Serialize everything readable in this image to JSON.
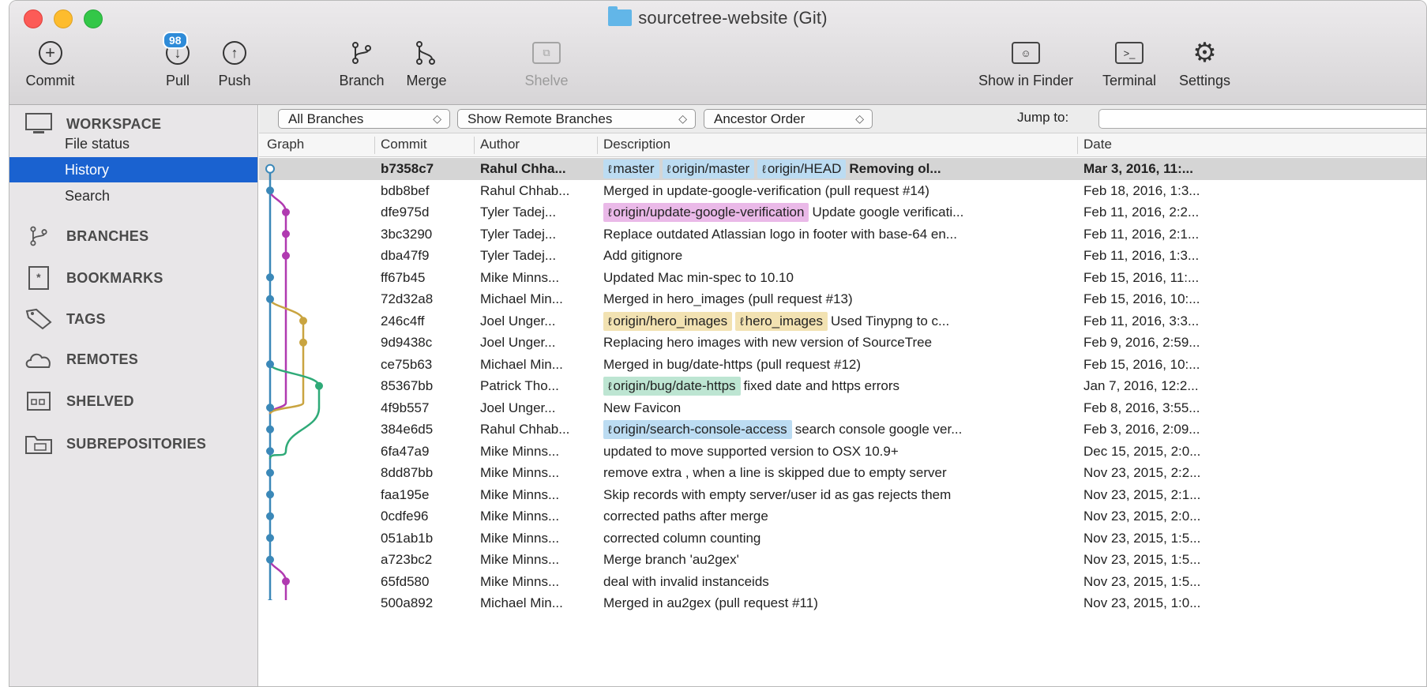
{
  "window": {
    "title": "sourcetree-website (Git)"
  },
  "toolbar": {
    "commit": "Commit",
    "pull": "Pull",
    "pull_badge": "98",
    "push": "Push",
    "branch": "Branch",
    "merge": "Merge",
    "shelve": "Shelve",
    "show_in_finder": "Show in Finder",
    "terminal": "Terminal",
    "settings": "Settings"
  },
  "sidebar": {
    "workspace": "WORKSPACE",
    "workspace_items": [
      "File status",
      "History",
      "Search"
    ],
    "active_item": "History",
    "sections": [
      "BRANCHES",
      "BOOKMARKS",
      "TAGS",
      "REMOTES",
      "SHELVED",
      "SUBREPOSITORIES"
    ]
  },
  "filters": {
    "branches": "All Branches",
    "remote": "Show Remote Branches",
    "order": "Ancestor Order",
    "jump_label": "Jump to:"
  },
  "columns": {
    "graph": "Graph",
    "commit": "Commit",
    "author": "Author",
    "description": "Description",
    "date": "Date"
  },
  "colors": {
    "selected_sidebar": "#1a62d0",
    "lane_blue": "#3b88b8",
    "lane_pink": "#b03ab0",
    "lane_yellow": "#c9a440",
    "lane_green": "#2faa78"
  },
  "commits": [
    {
      "hash": "b7358c7",
      "author": "Rahul Chha...",
      "tags": [
        {
          "label": "master",
          "color": "blue"
        },
        {
          "label": "origin/master",
          "color": "blue"
        },
        {
          "label": "origin/HEAD",
          "color": "blue"
        }
      ],
      "desc": "Removing ol...",
      "date": "Mar 3, 2016, 11:...",
      "selected": true
    },
    {
      "hash": "bdb8bef",
      "author": "Rahul Chhab...",
      "tags": [],
      "desc": "Merged in update-google-verification (pull request #14)",
      "date": "Feb 18, 2016, 1:3..."
    },
    {
      "hash": "dfe975d",
      "author": "Tyler Tadej...",
      "tags": [
        {
          "label": "origin/update-google-verification",
          "color": "pink"
        }
      ],
      "desc": "Update google verificati...",
      "date": "Feb 11, 2016, 2:2..."
    },
    {
      "hash": "3bc3290",
      "author": "Tyler Tadej...",
      "tags": [],
      "desc": "Replace outdated Atlassian logo in footer with base-64 en...",
      "date": "Feb 11, 2016, 2:1..."
    },
    {
      "hash": "dba47f9",
      "author": "Tyler Tadej...",
      "tags": [],
      "desc": "Add gitignore",
      "date": "Feb 11, 2016, 1:3..."
    },
    {
      "hash": "ff67b45",
      "author": "Mike Minns...",
      "tags": [],
      "desc": "Updated Mac min-spec to 10.10",
      "date": "Feb 15, 2016, 11:..."
    },
    {
      "hash": "72d32a8",
      "author": "Michael Min...",
      "tags": [],
      "desc": "Merged in hero_images (pull request #13)",
      "date": "Feb 15, 2016, 10:..."
    },
    {
      "hash": "246c4ff",
      "author": "Joel Unger...",
      "tags": [
        {
          "label": "origin/hero_images",
          "color": "yellow"
        },
        {
          "label": "hero_images",
          "color": "yellow"
        }
      ],
      "desc": "Used Tinypng to c...",
      "date": "Feb 11, 2016, 3:3..."
    },
    {
      "hash": "9d9438c",
      "author": "Joel Unger...",
      "tags": [],
      "desc": "Replacing hero images with new version of SourceTree",
      "date": "Feb 9, 2016, 2:59..."
    },
    {
      "hash": "ce75b63",
      "author": "Michael Min...",
      "tags": [],
      "desc": "Merged in bug/date-https (pull request #12)",
      "date": "Feb 15, 2016, 10:..."
    },
    {
      "hash": "85367bb",
      "author": "Patrick Tho...",
      "tags": [
        {
          "label": "origin/bug/date-https",
          "color": "green"
        }
      ],
      "desc": "fixed date and https errors",
      "date": "Jan 7, 2016, 12:2..."
    },
    {
      "hash": "4f9b557",
      "author": "Joel Unger...",
      "tags": [],
      "desc": "New Favicon",
      "date": "Feb 8, 2016, 3:55..."
    },
    {
      "hash": "384e6d5",
      "author": "Rahul Chhab...",
      "tags": [
        {
          "label": "origin/search-console-access",
          "color": "blue"
        }
      ],
      "desc": "search console google ver...",
      "date": "Feb 3, 2016, 2:09..."
    },
    {
      "hash": "6fa47a9",
      "author": "Mike Minns...",
      "tags": [],
      "desc": "updated to move supported version to OSX 10.9+",
      "date": "Dec 15, 2015, 2:0..."
    },
    {
      "hash": "8dd87bb",
      "author": "Mike Minns...",
      "tags": [],
      "desc": "remove extra , when a line is skipped due to empty server",
      "date": "Nov 23, 2015, 2:2..."
    },
    {
      "hash": "faa195e",
      "author": "Mike Minns...",
      "tags": [],
      "desc": "Skip records with empty server/user id as gas rejects them",
      "date": "Nov 23, 2015, 2:1..."
    },
    {
      "hash": "0cdfe96",
      "author": "Mike Minns...",
      "tags": [],
      "desc": "corrected paths after merge",
      "date": "Nov 23, 2015, 2:0..."
    },
    {
      "hash": "051ab1b",
      "author": "Mike Minns...",
      "tags": [],
      "desc": "corrected column counting",
      "date": "Nov 23, 2015, 1:5..."
    },
    {
      "hash": "a723bc2",
      "author": "Mike Minns...",
      "tags": [],
      "desc": "Merge branch 'au2gex'",
      "date": "Nov 23, 2015, 1:5..."
    },
    {
      "hash": "65fd580",
      "author": "Mike Minns...",
      "tags": [],
      "desc": "deal with invalid instanceids",
      "date": "Nov 23, 2015, 1:5..."
    },
    {
      "hash": "500a892",
      "author": "Michael Min...",
      "tags": [],
      "desc": "Merged in au2gex (pull request #11)",
      "date": "Nov 23, 2015, 1:0..."
    }
  ]
}
